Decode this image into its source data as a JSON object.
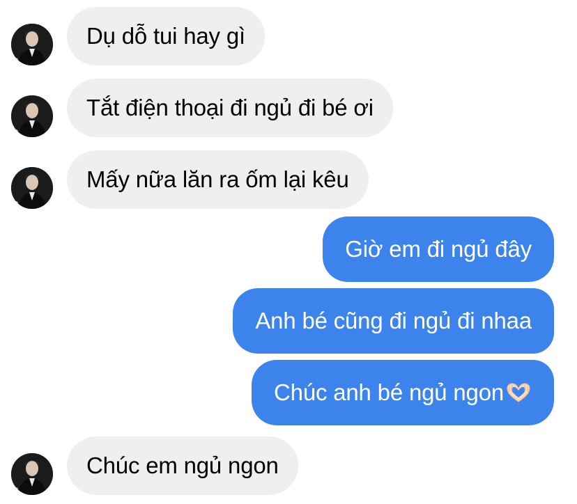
{
  "conversation": {
    "messages": [
      {
        "direction": "incoming",
        "text": "Dụ dỗ tui hay gì"
      },
      {
        "direction": "incoming",
        "text": "Tắt điện thoại đi ngủ đi bé ơi"
      },
      {
        "direction": "incoming",
        "text": "Mấy nữa lăn ra ốm lại kêu"
      },
      {
        "direction": "outgoing",
        "text": "Giờ em đi ngủ đây"
      },
      {
        "direction": "outgoing",
        "text": "Anh bé cũng đi ngủ đi nhaa"
      },
      {
        "direction": "outgoing",
        "text": "Chúc anh bé ngủ ngon",
        "emoji": "heart-hands-emoji"
      },
      {
        "direction": "incoming",
        "text": "Chúc em ngủ ngon"
      }
    ]
  },
  "colors": {
    "incoming_bubble": "#efefef",
    "outgoing_bubble": "#3c83ec",
    "incoming_text": "#000000",
    "outgoing_text": "#ffffff"
  }
}
